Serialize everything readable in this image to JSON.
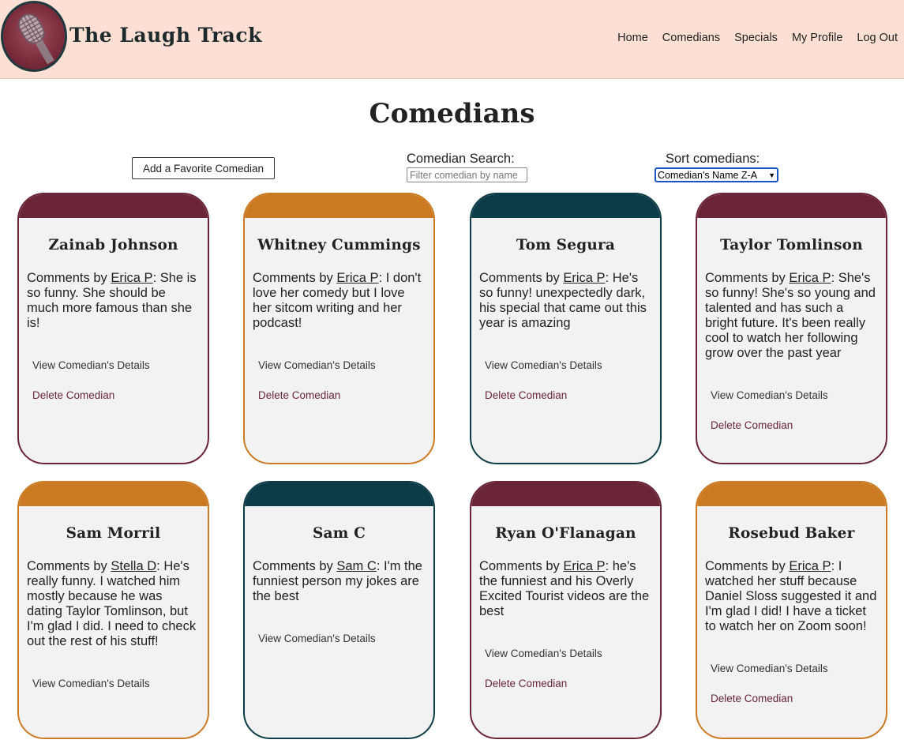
{
  "colors": {
    "header_bg": "#fde0d3",
    "maroon": "#6a2538",
    "orange": "#cc7a22",
    "teal": "#0d3c48",
    "card_bg": "#f2f2f2",
    "select_border": "#1a55c4"
  },
  "header": {
    "logo_icon": "microphone-icon",
    "title": "The Laugh Track",
    "nav": [
      "Home",
      "Comedians",
      "Specials",
      "My Profile",
      "Log Out"
    ]
  },
  "page": {
    "title": "Comedians"
  },
  "controls": {
    "add_label": "Add a Favorite Comedian",
    "search_label": "Comedian Search:",
    "search_placeholder": "Filter comedian by name",
    "sort_label": "Sort comedians:",
    "sort_value": "Comedian's Name Z-A"
  },
  "card_labels": {
    "comments_by": "Comments by ",
    "view_details": "View Comedian's Details",
    "delete": "Delete Comedian"
  },
  "comedians": [
    {
      "name": "Zainab Johnson",
      "author": "Erica P",
      "comment": ": She is so funny. She should be much more famous than she is!",
      "color": "maroon",
      "can_delete": true
    },
    {
      "name": "Whitney Cummings",
      "author": "Erica P",
      "comment": ": I don't love her comedy but I love her sitcom writing and her podcast!",
      "color": "orange",
      "can_delete": true
    },
    {
      "name": "Tom Segura",
      "author": "Erica P",
      "comment": ": He's so funny! unexpectedly dark, his special that came out this year is amazing",
      "color": "teal",
      "can_delete": true
    },
    {
      "name": "Taylor Tomlinson",
      "author": "Erica P",
      "comment": ": She's so funny! She's so young and talented and has such a bright future. It's been really cool to watch her following grow over the past year",
      "color": "maroon",
      "can_delete": true
    },
    {
      "name": "Sam Morril",
      "author": "Stella D",
      "comment": ": He's really funny. I watched him mostly because he was dating Taylor Tomlinson, but I'm glad I did. I need to check out the rest of his stuff!",
      "color": "orange",
      "can_delete": false
    },
    {
      "name": "Sam C",
      "author": "Sam C",
      "comment": ": I'm the funniest person my jokes are the best",
      "color": "teal",
      "can_delete": false
    },
    {
      "name": "Ryan O'Flanagan",
      "author": "Erica P",
      "comment": ": he's the funniest and his Overly Excited Tourist videos are the best",
      "color": "maroon",
      "can_delete": true
    },
    {
      "name": "Rosebud Baker",
      "author": "Erica P",
      "comment": ": I watched her stuff because Daniel Sloss suggested it and I'm glad I did! I have a ticket to watch her on Zoom soon!",
      "color": "orange",
      "can_delete": true
    }
  ]
}
